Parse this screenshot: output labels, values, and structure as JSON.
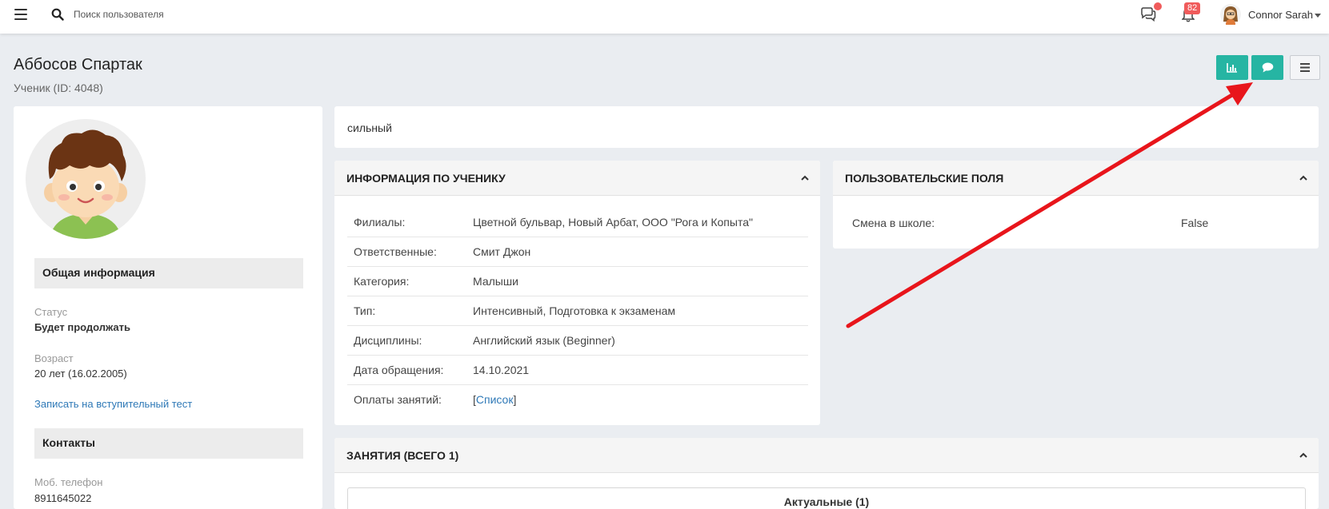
{
  "topbar": {
    "search_placeholder": "Поиск пользователя",
    "notifications_count": "82",
    "user_name": "Connor Sarah"
  },
  "header": {
    "title": "Аббосов Спартак",
    "subtitle": "Ученик (ID: 4048)"
  },
  "profile": {
    "general_section": "Общая информация",
    "status_label": "Статус",
    "status_value": "Будет продолжать",
    "age_label": "Возраст",
    "age_value": "20 лет (16.02.2005)",
    "test_link": "Записать на вступительный тест",
    "contacts_section": "Контакты",
    "phone_label": "Моб. телефон",
    "phone_value": "8911645022"
  },
  "note": {
    "text": "сильный"
  },
  "info": {
    "title": "ИНФОРМАЦИЯ ПО УЧЕНИКУ",
    "rows": [
      {
        "key": "Филиалы:",
        "value": "Цветной бульвар, Новый Арбат, ООО \"Рога и Копыта\""
      },
      {
        "key": "Ответственные:",
        "value": "Смит Джон"
      },
      {
        "key": "Категория:",
        "value": "Малыши"
      },
      {
        "key": "Тип:",
        "value": "Интенсивный, Подготовка к экзаменам"
      },
      {
        "key": "Дисциплины:",
        "value": "Английский язык (Beginner)"
      },
      {
        "key": "Дата обращения:",
        "value": "14.10.2021"
      },
      {
        "key": "Оплаты занятий:",
        "value": "Список"
      }
    ]
  },
  "custom_fields": {
    "title": "ПОЛЬЗОВАТЕЛЬСКИЕ ПОЛЯ",
    "key": "Смена в школе:",
    "value": "False"
  },
  "lessons": {
    "title": "ЗАНЯТИЯ (ВСЕГО 1)",
    "tab_label": "Актуальные (1)"
  },
  "colors": {
    "accent": "#26b5a3",
    "badge": "#f05b5b",
    "link": "#2f79b7",
    "annotation_arrow": "#e8151b"
  }
}
